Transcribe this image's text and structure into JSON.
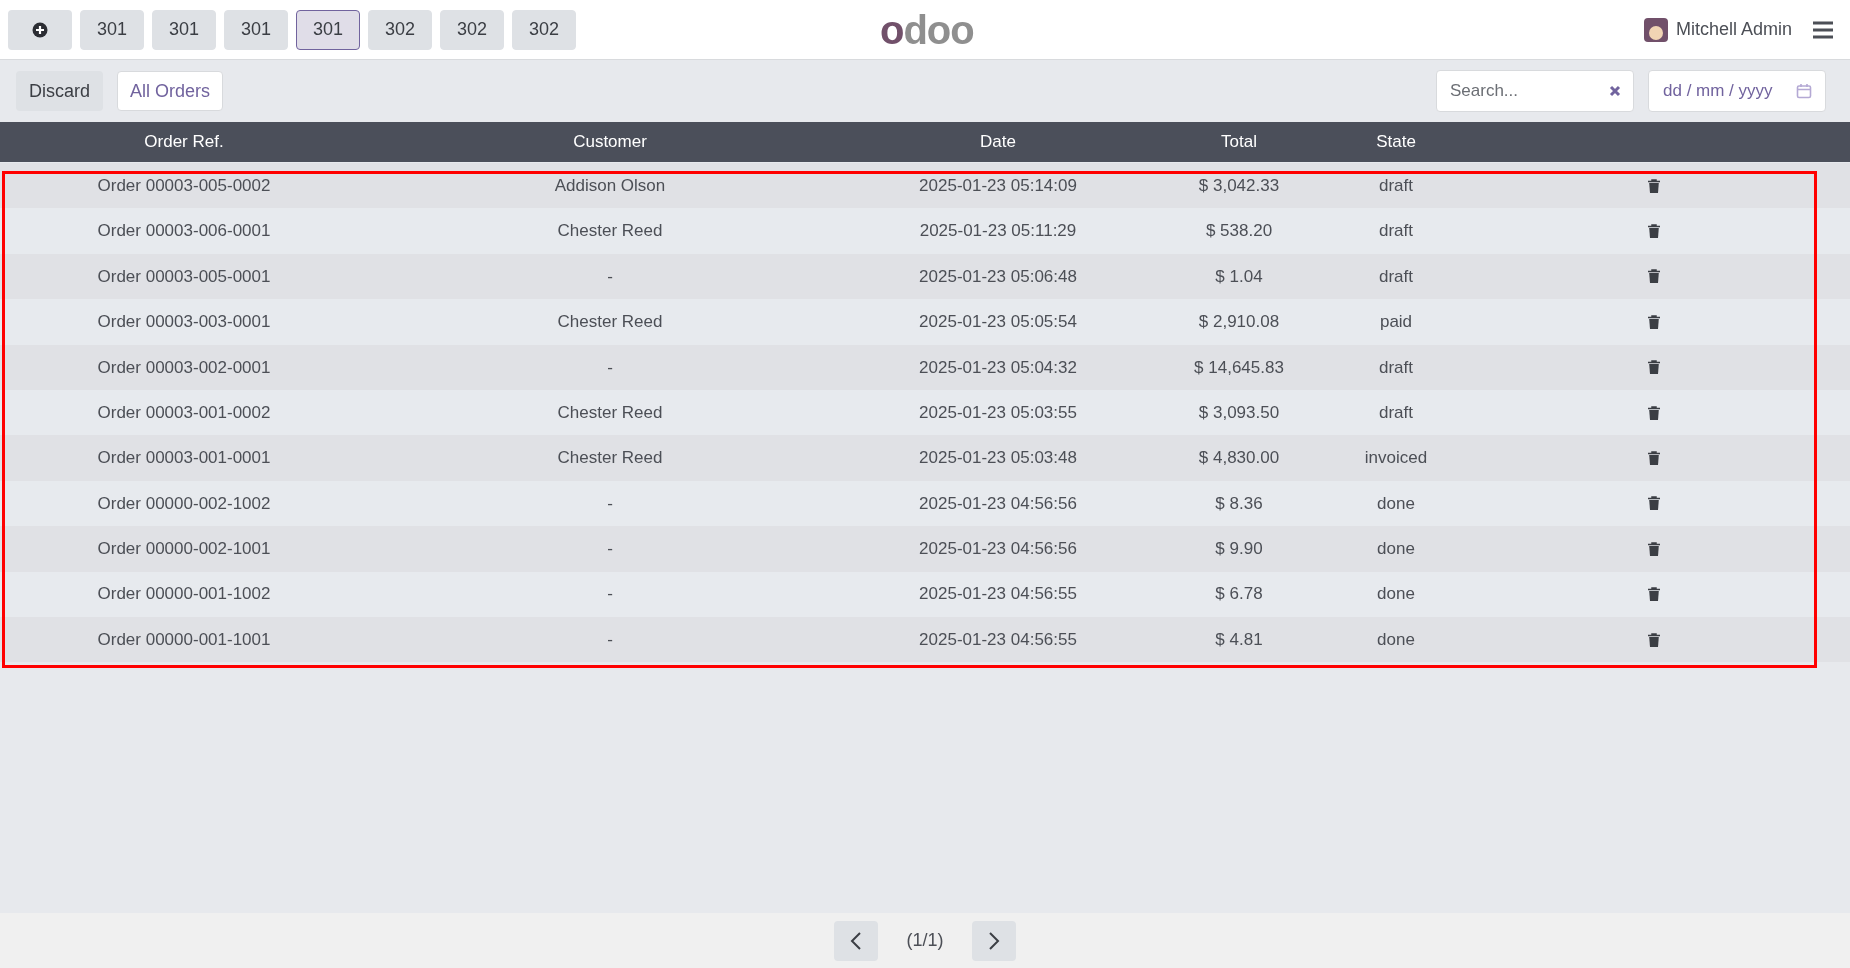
{
  "top_bar": {
    "tabs": [
      {
        "label": "301",
        "selected": false
      },
      {
        "label": "301",
        "selected": false
      },
      {
        "label": "301",
        "selected": false
      },
      {
        "label": "301",
        "selected": true
      },
      {
        "label": "302",
        "selected": false
      },
      {
        "label": "302",
        "selected": false
      },
      {
        "label": "302",
        "selected": false
      }
    ],
    "logo": "odoo",
    "user": "Mitchell Admin"
  },
  "toolbar": {
    "discard": "Discard",
    "filter": "All Orders",
    "search": {
      "placeholder": "Search..."
    },
    "date": {
      "placeholder": "dd / mm / yyyy"
    }
  },
  "table": {
    "columns": [
      "Order Ref.",
      "Customer",
      "Date",
      "Total",
      "State"
    ],
    "rows": [
      [
        "Order 00003-005-0002",
        "Addison Olson",
        "2025-01-23 05:14:09",
        "$ 3,042.33",
        "draft"
      ],
      [
        "Order 00003-006-0001",
        "Chester Reed",
        "2025-01-23 05:11:29",
        "$ 538.20",
        "draft"
      ],
      [
        "Order 00003-005-0001",
        "-",
        "2025-01-23 05:06:48",
        "$ 1.04",
        "draft"
      ],
      [
        "Order 00003-003-0001",
        "Chester Reed",
        "2025-01-23 05:05:54",
        "$ 2,910.08",
        "paid"
      ],
      [
        "Order 00003-002-0001",
        "-",
        "2025-01-23 05:04:32",
        "$ 14,645.83",
        "draft"
      ],
      [
        "Order 00003-001-0002",
        "Chester Reed",
        "2025-01-23 05:03:55",
        "$ 3,093.50",
        "draft"
      ],
      [
        "Order 00003-001-0001",
        "Chester Reed",
        "2025-01-23 05:03:48",
        "$ 4,830.00",
        "invoiced"
      ],
      [
        "Order 00000-002-1002",
        "-",
        "2025-01-23 04:56:56",
        "$ 8.36",
        "done"
      ],
      [
        "Order 00000-002-1001",
        "-",
        "2025-01-23 04:56:56",
        "$ 9.90",
        "done"
      ],
      [
        "Order 00000-001-1002",
        "-",
        "2025-01-23 04:56:55",
        "$ 6.78",
        "done"
      ],
      [
        "Order 00000-001-1001",
        "-",
        "2025-01-23 04:56:55",
        "$ 4.81",
        "done"
      ]
    ]
  },
  "pager": {
    "label": "(1/1)"
  }
}
